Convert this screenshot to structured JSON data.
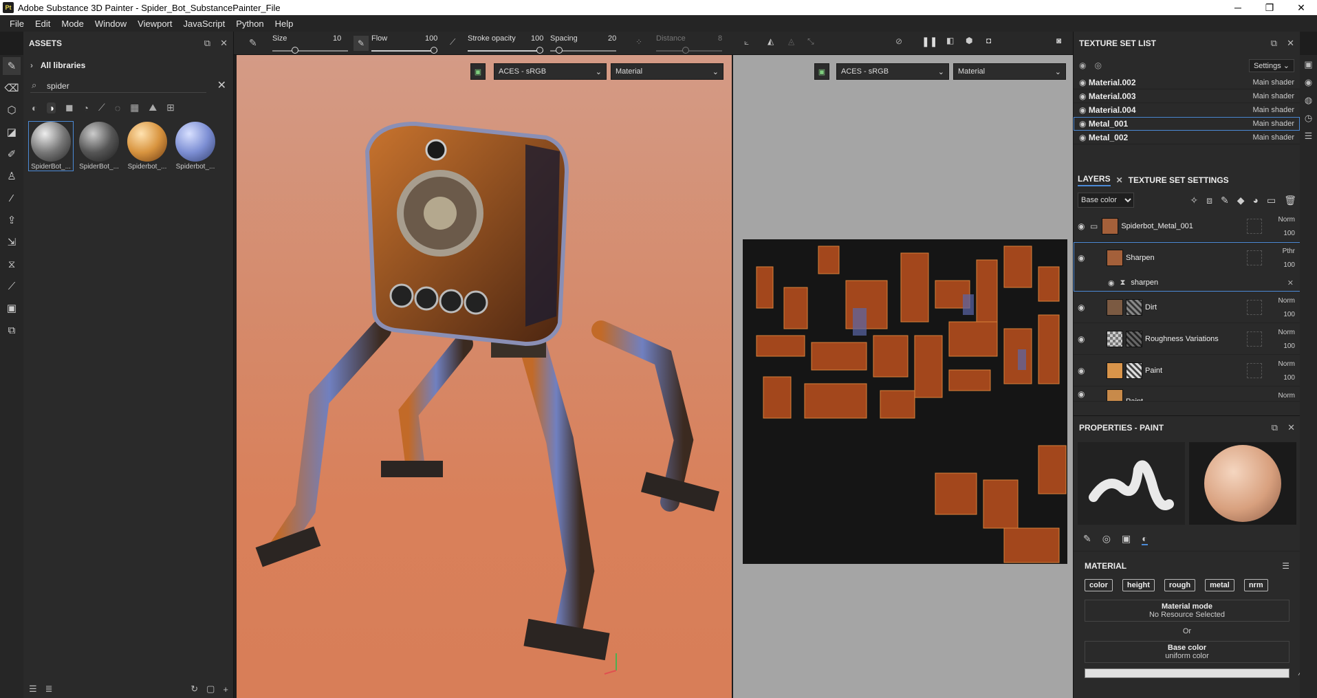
{
  "window": {
    "title": "Adobe Substance 3D Painter - Spider_Bot_SubstancePainter_File",
    "app_icon": "Pt"
  },
  "menu": [
    "File",
    "Edit",
    "Mode",
    "Window",
    "Viewport",
    "JavaScript",
    "Python",
    "Help"
  ],
  "toolbar": {
    "size_label": "Size",
    "size_value": "10",
    "flow_label": "Flow",
    "flow_value": "100",
    "stroke_opacity_label": "Stroke opacity",
    "stroke_opacity_value": "100",
    "spacing_label": "Spacing",
    "spacing_value": "20",
    "distance_label": "Distance",
    "distance_value": "8"
  },
  "assets": {
    "title": "ASSETS",
    "libraries": "All libraries",
    "search_value": "spider",
    "items": [
      {
        "label": "SpiderBot_...",
        "color": "#8a8a8a"
      },
      {
        "label": "SpiderBot_...",
        "color": "#5e5e5e"
      },
      {
        "label": "Spiderbot_...",
        "color": "#d89a5a"
      },
      {
        "label": "Spiderbot_...",
        "color": "#8899d6"
      }
    ]
  },
  "viewport": {
    "left": {
      "colorspace": "ACES - sRGB",
      "channel": "Material"
    },
    "right": {
      "colorspace": "ACES - sRGB",
      "channel": "Material"
    }
  },
  "texture_set_list": {
    "title": "TEXTURE SET LIST",
    "settings_label": "Settings",
    "items": [
      {
        "name": "Material.002",
        "shader": "Main shader"
      },
      {
        "name": "Material.003",
        "shader": "Main shader"
      },
      {
        "name": "Material.004",
        "shader": "Main shader"
      },
      {
        "name": "Metal_001",
        "shader": "Main shader"
      },
      {
        "name": "Metal_002",
        "shader": "Main shader"
      }
    ]
  },
  "layers": {
    "tab_layers": "LAYERS",
    "tab_texture_settings": "TEXTURE SET SETTINGS",
    "channel_select": "Base color",
    "items": [
      {
        "name": "Spiderbot_Metal_001",
        "blend": "Norm",
        "opacity": "100"
      },
      {
        "name": "Sharpen",
        "blend": "Pthr",
        "opacity": "100",
        "effect": "sharpen"
      },
      {
        "name": "Dirt",
        "blend": "Norm",
        "opacity": "100"
      },
      {
        "name": "Roughness Variations",
        "blend": "Norm",
        "opacity": "100"
      },
      {
        "name": "Paint",
        "blend": "Norm",
        "opacity": "100"
      },
      {
        "name": "Paint",
        "blend": "Norm",
        "opacity": ""
      }
    ]
  },
  "properties": {
    "title": "PROPERTIES - PAINT",
    "material_header": "MATERIAL",
    "channels": [
      "color",
      "height",
      "rough",
      "metal",
      "nrm"
    ],
    "material_mode_label": "Material mode",
    "material_mode_value": "No Resource Selected",
    "or_label": "Or",
    "base_color_label": "Base color",
    "base_color_value": "uniform color"
  }
}
